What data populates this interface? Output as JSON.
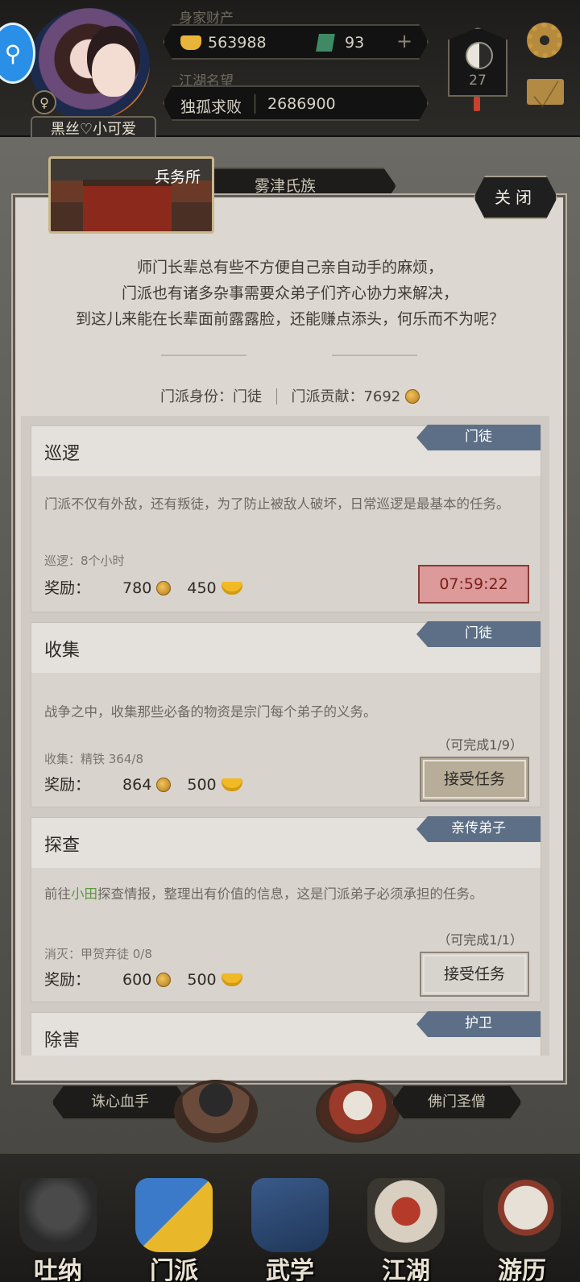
{
  "header": {
    "wealth_label": "身家财产",
    "gold": "563988",
    "jade": "93",
    "plus": "+",
    "fame_label": "江湖名望",
    "title": "独孤求败",
    "fame": "2686900",
    "level": "27",
    "player_name": "黑丝♡小可爱",
    "gender_symbol": "♀"
  },
  "background": {
    "clan_name": "雾津氏族",
    "left_villain": "诛心血手",
    "right_monk": "佛门圣僧"
  },
  "panel": {
    "title": "兵务所",
    "close_label": "关闭",
    "intro": [
      "师门长辈总有些不方便自己亲自动手的麻烦，",
      "门派也有诸多杂事需要众弟子们齐心协力来解决，",
      "到这儿来能在长辈面前露露脸，还能赚点添头，何乐而不为呢？"
    ],
    "identity_label": "门派身份：",
    "identity": "门徒",
    "contribution_label": "门派贡献：",
    "contribution": "7692"
  },
  "tasks": [
    {
      "title": "巡逻",
      "tag": "门徒",
      "desc": "门派不仅有外敌，还有叛徒，为了防止被敌人破坏，日常巡逻是最基本的任务。",
      "req": "巡逻：8个小时",
      "reward_label": "奖励：",
      "reward_coin": "780",
      "reward_gold": "450",
      "timer": "07:59:22"
    },
    {
      "title": "收集",
      "tag": "门徒",
      "desc": "战争之中，收集那些必备的物资是宗门每个弟子的义务。",
      "req": "收集：精铁 364/8",
      "reward_label": "奖励：",
      "reward_coin": "864",
      "reward_gold": "500",
      "avail": "（可完成1/9）",
      "button": "接受任务"
    },
    {
      "title": "探查",
      "tag": "亲传弟子",
      "desc_pre": "前往",
      "desc_hl": "小田",
      "desc_post": "探查情报，整理出有价值的信息，这是门派弟子必须承担的任务。",
      "req": "消灭：甲贺弃徒 0/8",
      "reward_label": "奖励：",
      "reward_coin": "600",
      "reward_gold": "500",
      "avail": "（可完成1/1）",
      "button": "接受任务"
    },
    {
      "title": "除害",
      "tag": "护卫"
    }
  ],
  "nav": [
    "吐纳",
    "门派",
    "武学",
    "江湖",
    "游历"
  ],
  "colors": {
    "tag_blue": "#5c6f86",
    "timer_red": "#dc9a9a",
    "highlight_green": "#5b9a3c",
    "gold": "#e8b43a"
  }
}
